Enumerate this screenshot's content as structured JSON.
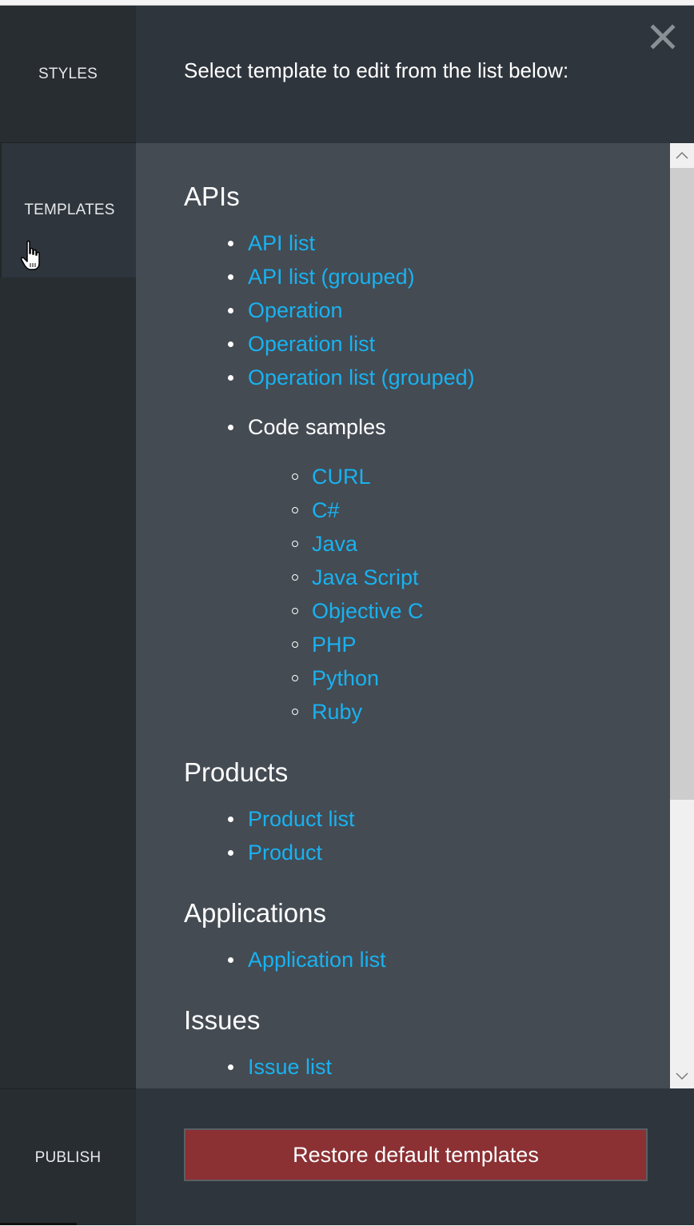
{
  "sidebar": {
    "styles_label": "STYLES",
    "templates_label": "TEMPLATES",
    "publish_label": "PUBLISH"
  },
  "header": {
    "title": "Select template to edit from the list below:",
    "close_icon": "close-icon"
  },
  "sections": {
    "apis": {
      "heading": "APIs",
      "items": [
        "API list",
        "API list (grouped)",
        "Operation",
        "Operation list",
        "Operation list (grouped)"
      ],
      "code_samples_label": "Code samples",
      "code_samples": [
        "CURL",
        "C#",
        "Java",
        "Java Script",
        "Objective C",
        "PHP",
        "Python",
        "Ruby"
      ]
    },
    "products": {
      "heading": "Products",
      "items": [
        "Product list",
        "Product"
      ]
    },
    "applications": {
      "heading": "Applications",
      "items": [
        "Application list"
      ]
    },
    "issues": {
      "heading": "Issues",
      "items": [
        "Issue list"
      ]
    }
  },
  "footer": {
    "restore_label": "Restore default templates"
  },
  "colors": {
    "link": "#19b2f0",
    "sidebar_bg": "#282d31",
    "header_bg": "#2f353d",
    "content_bg": "#444b53",
    "restore_bg": "#8b3033"
  }
}
